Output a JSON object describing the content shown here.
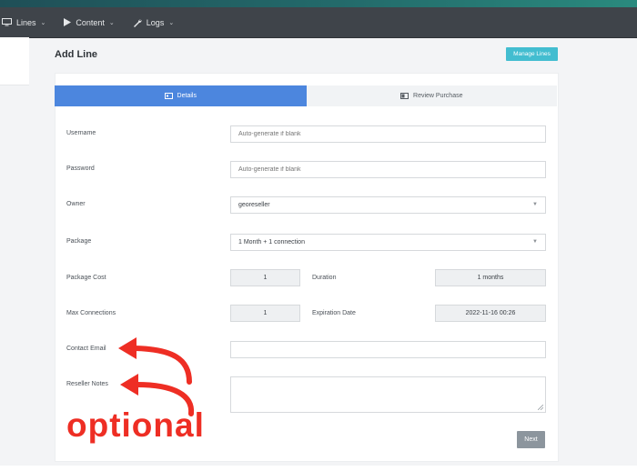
{
  "nav": {
    "items": [
      {
        "label": "Lines",
        "icon": "monitor-icon"
      },
      {
        "label": "Content",
        "icon": "play-icon"
      },
      {
        "label": "Logs",
        "icon": "wrench-icon"
      }
    ]
  },
  "page": {
    "title": "Add Line",
    "manage_button": "Manage Lines"
  },
  "tabs": [
    {
      "label": "Details",
      "icon": "id-card-icon",
      "active": true
    },
    {
      "label": "Review Purchase",
      "icon": "list-icon",
      "active": false
    }
  ],
  "form": {
    "username": {
      "label": "Username",
      "placeholder": "Auto-generate if blank",
      "value": ""
    },
    "password": {
      "label": "Password",
      "placeholder": "Auto-generate if blank",
      "value": ""
    },
    "owner": {
      "label": "Owner",
      "value": "georeseller"
    },
    "package": {
      "label": "Package",
      "value": "1 Month + 1 connection"
    },
    "package_cost": {
      "label": "Package Cost",
      "value": "1"
    },
    "duration": {
      "label": "Duration",
      "value": "1 months"
    },
    "max_connections": {
      "label": "Max Connections",
      "value": "1"
    },
    "expiration_date": {
      "label": "Expiration Date",
      "value": "2022-11-16 00:26"
    },
    "contact_email": {
      "label": "Contact Email",
      "value": ""
    },
    "reseller_notes": {
      "label": "Reseller Notes",
      "value": ""
    },
    "next_button": "Next"
  },
  "annotation": {
    "text": "optional",
    "color": "#ee2e24"
  },
  "colors": {
    "navbar": "#3f444a",
    "active_tab": "#4c86de",
    "manage_button": "#43bdd0",
    "next_button": "#8c959d"
  }
}
